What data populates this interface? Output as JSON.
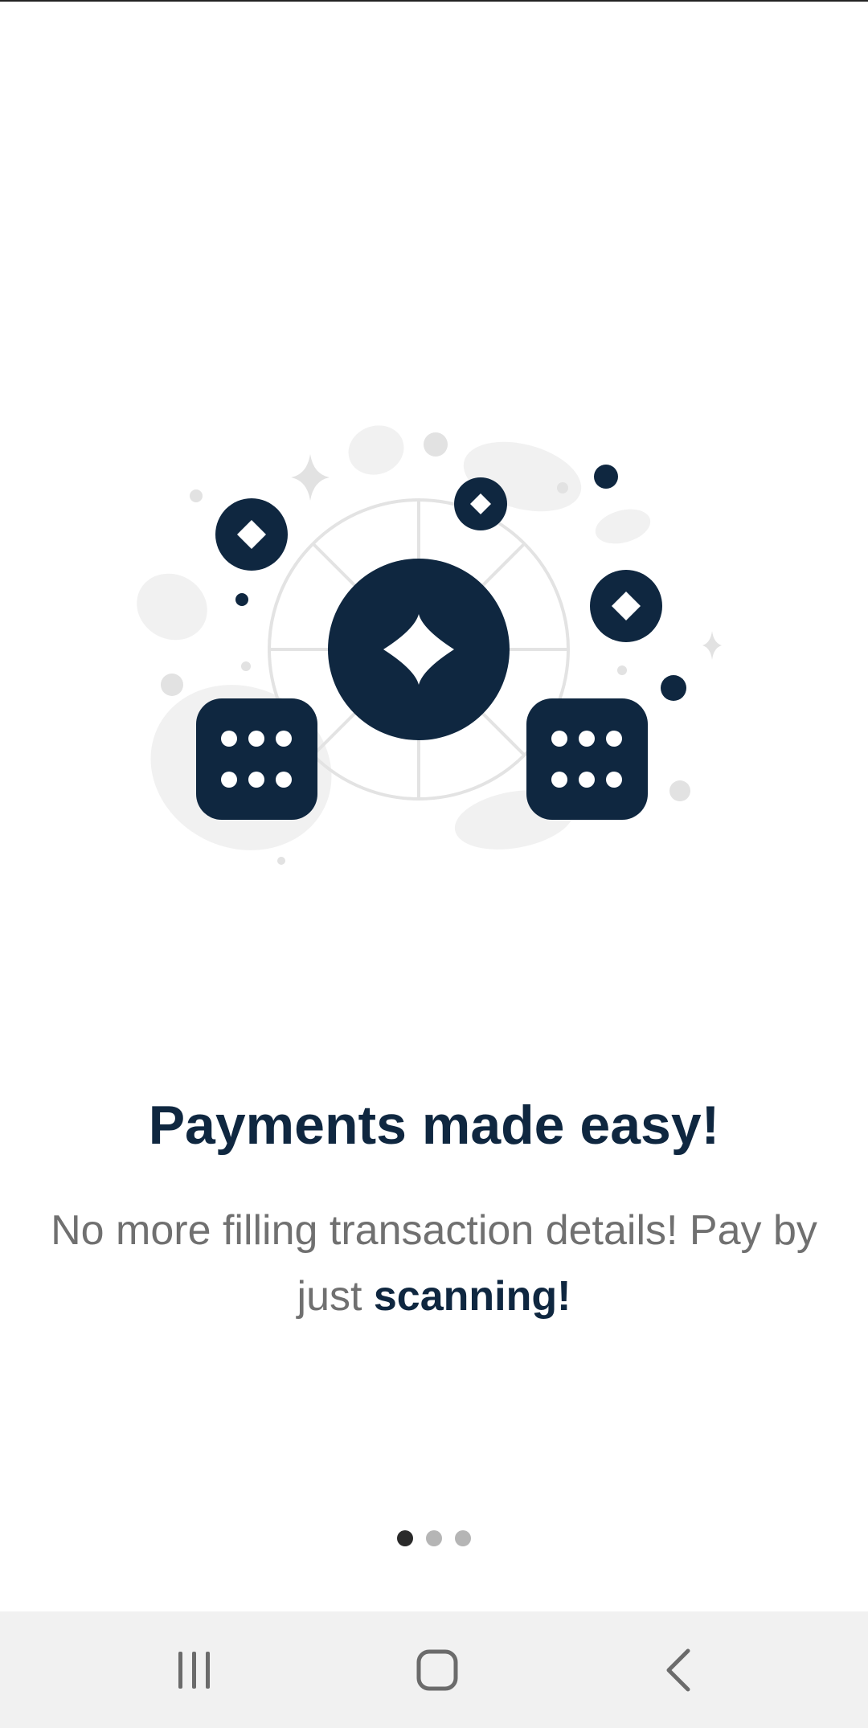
{
  "onboarding": {
    "title": "Payments made easy!",
    "subtitle_plain": "No more filling transaction details! Pay by just ",
    "subtitle_emphasis": "scanning!",
    "pager": {
      "total_pages": 3,
      "current_page": 1
    }
  },
  "illustration": {
    "icon_name": "casino-chips-dice-illustration",
    "primary_color": "#0f2740",
    "accent_color": "#e6e6e6"
  },
  "navbar": {
    "recents_icon": "recents-icon",
    "home_icon": "home-icon",
    "back_icon": "back-icon",
    "background_color": "#f1f1f1"
  },
  "colors": {
    "title": "#0f2740",
    "body_text": "#707070",
    "dot_active": "#2a2a2a",
    "dot_inactive": "#b5b5b5"
  }
}
